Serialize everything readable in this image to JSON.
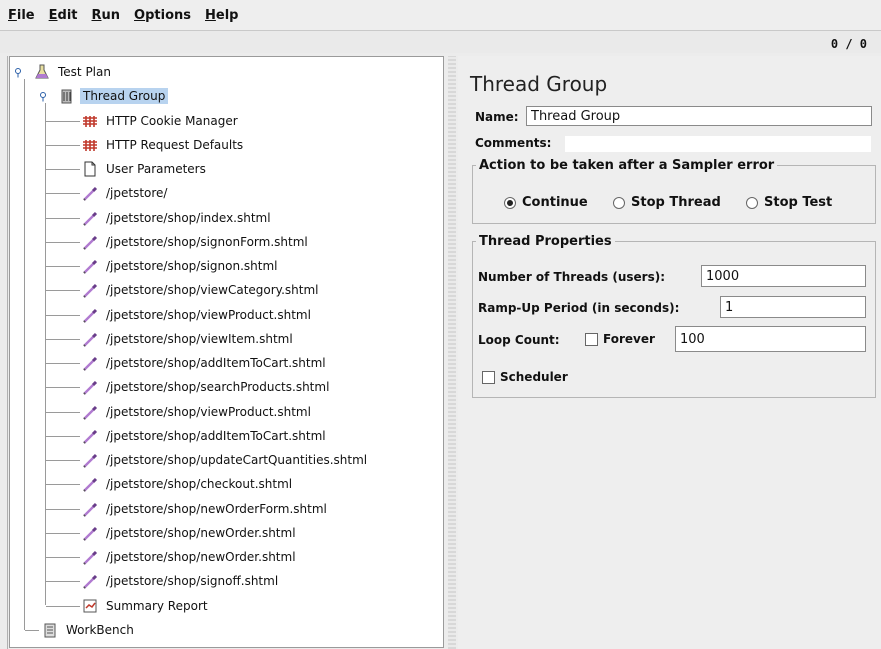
{
  "menu": [
    {
      "label": "File",
      "u": "F",
      "rest": "ile"
    },
    {
      "label": "Edit",
      "u": "E",
      "rest": "dit"
    },
    {
      "label": "Run",
      "u": "R",
      "rest": "un"
    },
    {
      "label": "Options",
      "u": "O",
      "rest": "ptions"
    },
    {
      "label": "Help",
      "u": "H",
      "rest": "elp"
    }
  ],
  "status": {
    "counter": "0 / 0"
  },
  "tree": {
    "root": "Test Plan",
    "group": "Thread Group",
    "items": [
      "HTTP Cookie Manager",
      "HTTP Request Defaults",
      "User Parameters",
      "/jpetstore/",
      "/jpetstore/shop/index.shtml",
      "/jpetstore/shop/signonForm.shtml",
      "/jpetstore/shop/signon.shtml",
      "/jpetstore/shop/viewCategory.shtml",
      "/jpetstore/shop/viewProduct.shtml",
      "/jpetstore/shop/viewItem.shtml",
      "/jpetstore/shop/addItemToCart.shtml",
      "/jpetstore/shop/searchProducts.shtml",
      "/jpetstore/shop/viewProduct.shtml",
      "/jpetstore/shop/addItemToCart.shtml",
      "/jpetstore/shop/updateCartQuantities.shtml",
      "/jpetstore/shop/checkout.shtml",
      "/jpetstore/shop/newOrderForm.shtml",
      "/jpetstore/shop/newOrder.shtml",
      "/jpetstore/shop/newOrder.shtml",
      "/jpetstore/shop/signoff.shtml",
      "Summary Report"
    ],
    "workbench": "WorkBench"
  },
  "panel": {
    "title": "Thread Group",
    "name_label": "Name:",
    "name_value": "Thread Group",
    "comments_label": "Comments:",
    "comments_value": "",
    "error_legend": "Action to be taken after a Sampler error",
    "opt_continue": "Continue",
    "opt_stop_thread": "Stop Thread",
    "opt_stop_test": "Stop Test",
    "props_legend": "Thread Properties",
    "threads_label": "Number of Threads (users):",
    "threads_value": "1000",
    "rampup_label": "Ramp-Up Period (in seconds):",
    "rampup_value": "1",
    "loop_label": "Loop Count:",
    "forever_label": "Forever",
    "loop_value": "100",
    "scheduler_label": "Scheduler"
  }
}
